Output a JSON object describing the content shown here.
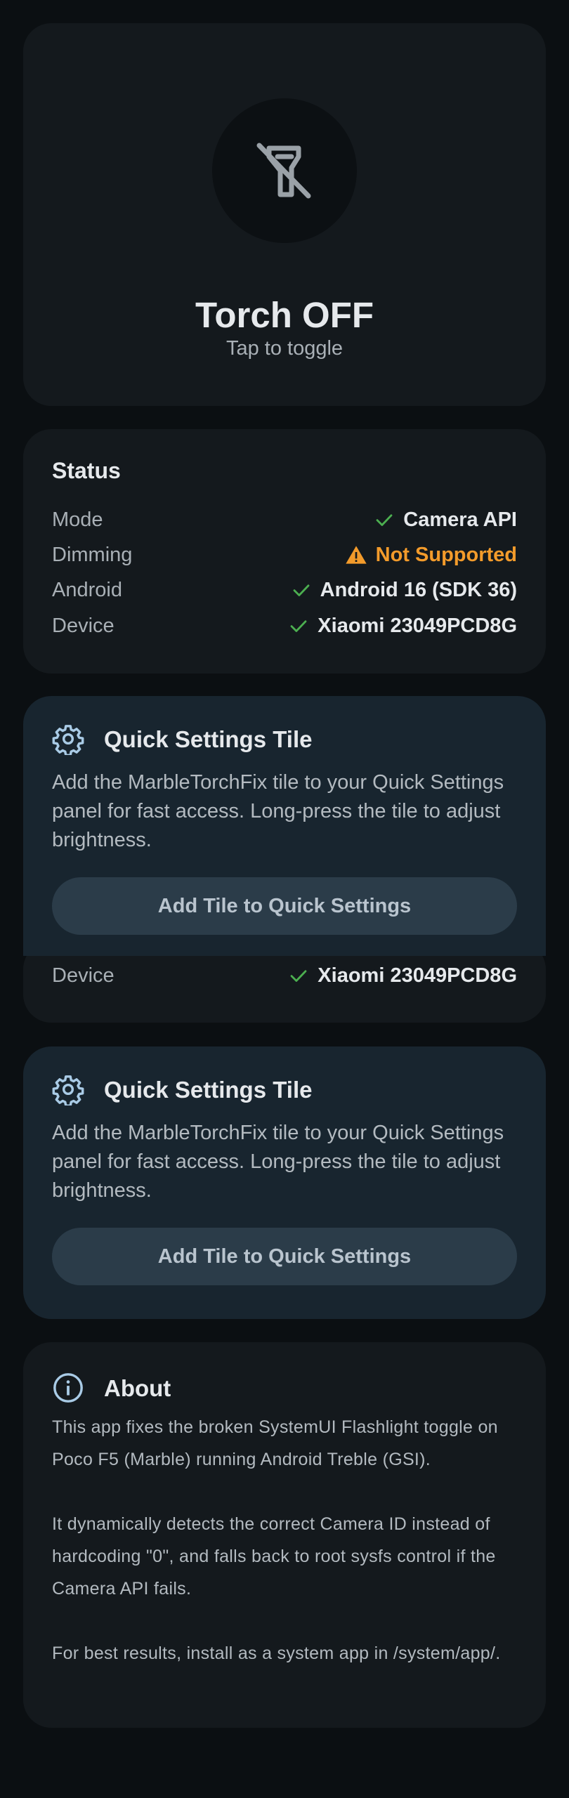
{
  "torch": {
    "title": "Torch OFF",
    "subtitle": "Tap to toggle",
    "icon": "flashlight-off-icon"
  },
  "status": {
    "title": "Status",
    "rows": [
      {
        "label": "Mode",
        "value": "Camera API",
        "state": "ok"
      },
      {
        "label": "Dimming",
        "value": "Not Supported",
        "state": "warn"
      },
      {
        "label": "Android",
        "value": "Android 16 (SDK 36)",
        "state": "ok"
      },
      {
        "label": "Device",
        "value": "Xiaomi 23049PCD8G",
        "state": "ok"
      }
    ],
    "peek_row": {
      "label": "Device",
      "value": "Xiaomi 23049PCD8G"
    }
  },
  "quick_settings": {
    "title": "Quick Settings Tile",
    "description": "Add the MarbleTorchFix tile to your Quick Settings panel for fast access. Long-press the tile to adjust brightness.",
    "button_label": "Add Tile to Quick Settings",
    "icon": "gear-icon"
  },
  "about": {
    "title": "About",
    "icon": "info-icon",
    "paragraphs": [
      "This app fixes the broken SystemUI Flashlight toggle on Poco F5 (Marble) running Android Treble (GSI).",
      "It dynamically detects the correct Camera ID instead of hardcoding \"0\", and falls back to root sysfs control if the Camera API fails.",
      "For best results, install as a system app in /system/app/."
    ]
  },
  "colors": {
    "background": "#0b0f12",
    "card": "#14191d",
    "tile_card": "#18252f",
    "ok_check": "#4caf50",
    "warning": "#f39b2b",
    "button": "#2b3c49"
  }
}
